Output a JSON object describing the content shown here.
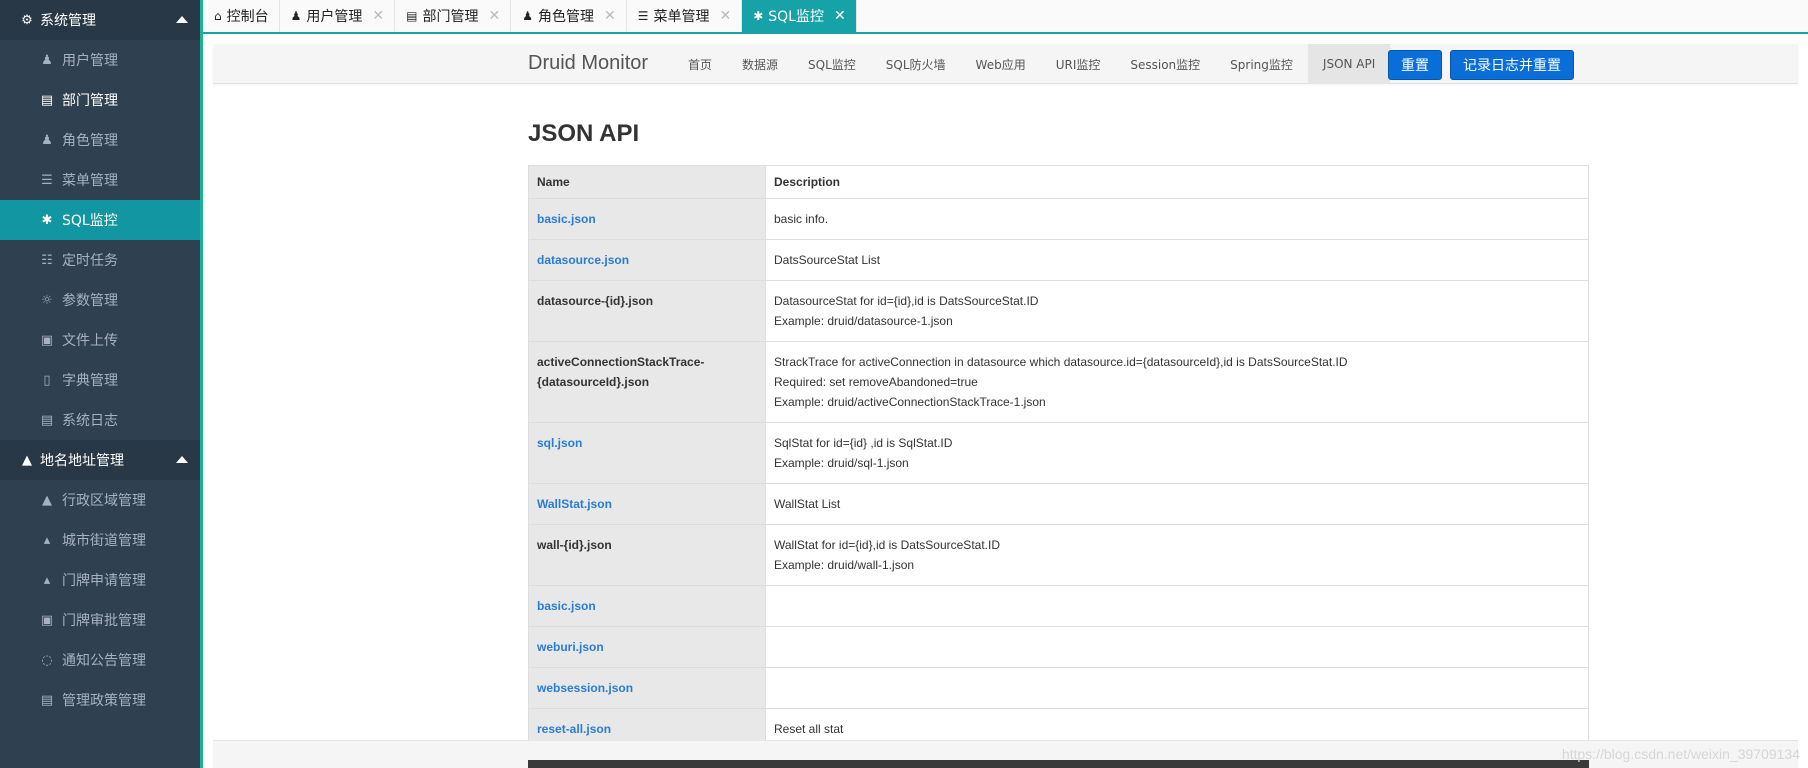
{
  "sidebar": {
    "groups": [
      {
        "title": "系统管理",
        "icon": "gear-icon",
        "items": [
          {
            "label": "用户管理",
            "icon": "user-icon"
          },
          {
            "label": "部门管理",
            "icon": "chart-file-icon"
          },
          {
            "label": "角色管理",
            "icon": "role-icon"
          },
          {
            "label": "菜单管理",
            "icon": "list-icon"
          },
          {
            "label": "SQL监控",
            "icon": "bug-icon"
          },
          {
            "label": "定时任务",
            "icon": "tasks-icon"
          },
          {
            "label": "参数管理",
            "icon": "cog-icon"
          },
          {
            "label": "文件上传",
            "icon": "image-icon"
          },
          {
            "label": "字典管理",
            "icon": "bookmark-icon"
          },
          {
            "label": "系统日志",
            "icon": "file-icon"
          }
        ]
      },
      {
        "title": "地名地址管理",
        "icon": "area-chart-icon",
        "items": [
          {
            "label": "行政区域管理",
            "icon": "area-chart-icon"
          },
          {
            "label": "城市街道管理",
            "icon": "street-icon"
          },
          {
            "label": "门牌申请管理",
            "icon": "street-icon"
          },
          {
            "label": "门牌审批管理",
            "icon": "contact-icon"
          },
          {
            "label": "通知公告管理",
            "icon": "notice-icon"
          },
          {
            "label": "管理政策管理",
            "icon": "file-text-icon"
          }
        ]
      }
    ]
  },
  "tabs": [
    {
      "label": "控制台",
      "icon": "home-icon"
    },
    {
      "label": "用户管理",
      "icon": "user-icon"
    },
    {
      "label": "部门管理",
      "icon": "chart-file-icon"
    },
    {
      "label": "角色管理",
      "icon": "role-icon"
    },
    {
      "label": "菜单管理",
      "icon": "list-icon"
    },
    {
      "label": "SQL监控",
      "icon": "bug-icon"
    }
  ],
  "druid": {
    "brand": "Druid Monitor",
    "nav": [
      "首页",
      "数据源",
      "SQL监控",
      "SQL防火墙",
      "Web应用",
      "URI监控",
      "Session监控",
      "Spring监控",
      "JSON API"
    ],
    "reset_label": "重置",
    "log_reset_label": "记录日志并重置",
    "page_title": "JSON API",
    "table": {
      "headers": [
        "Name",
        "Description"
      ],
      "rows": [
        {
          "name": "basic.json",
          "link": true,
          "desc": [
            "basic info."
          ]
        },
        {
          "name": "datasource.json",
          "link": true,
          "desc": [
            "DatsSourceStat List"
          ]
        },
        {
          "name": "datasource-{id}.json",
          "link": false,
          "desc": [
            "DatasourceStat for id={id},id is DatsSourceStat.ID",
            "Example: druid/datasource-1.json"
          ]
        },
        {
          "name": "activeConnectionStackTrace-{datasourceId}.json",
          "link": false,
          "desc": [
            "StrackTrace for activeConnection in datasource which datasource.id={datasourceId},id is DatsSourceStat.ID",
            "Required: set removeAbandoned=true",
            "Example: druid/activeConnectionStackTrace-1.json"
          ]
        },
        {
          "name": "sql.json",
          "link": true,
          "desc": [
            "SqlStat for id={id} ,id is SqlStat.ID",
            "Example: druid/sql-1.json"
          ]
        },
        {
          "name": "WallStat.json",
          "link": true,
          "desc": [
            "WallStat List"
          ]
        },
        {
          "name": "wall-{id}.json",
          "link": false,
          "desc": [
            "WallStat for id={id},id is DatsSourceStat.ID",
            "Example: druid/wall-1.json"
          ]
        },
        {
          "name": "basic.json",
          "link": true,
          "desc": []
        },
        {
          "name": "weburi.json",
          "link": true,
          "desc": []
        },
        {
          "name": "websession.json",
          "link": true,
          "desc": []
        },
        {
          "name": "reset-all.json",
          "link": true,
          "desc": [
            "Reset all stat"
          ]
        }
      ]
    }
  },
  "watermark": "https://blog.csdn.net/weixin_39709134",
  "colors": {
    "sidebar_bg": "#2f4050",
    "active_teal": "#17a2a8",
    "button_blue": "#0a6ed8",
    "link_blue": "#2a7bd3"
  }
}
